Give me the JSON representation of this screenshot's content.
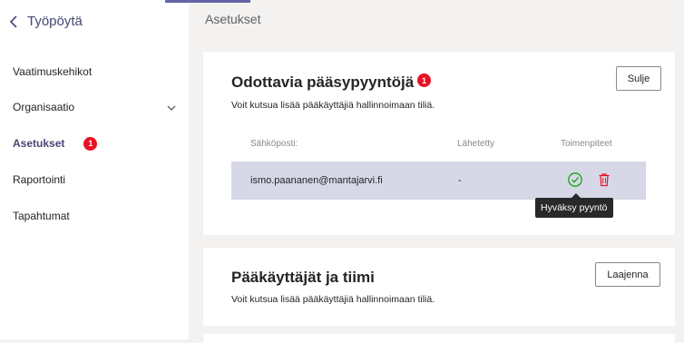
{
  "sidebar": {
    "back_label": "Työpöytä",
    "items": [
      {
        "label": "Vaatimuskehikot"
      },
      {
        "label": "Organisaatio"
      },
      {
        "label": "Asetukset",
        "badge": "1"
      },
      {
        "label": "Raportointi"
      },
      {
        "label": "Tapahtumat"
      }
    ]
  },
  "header": {
    "title": "Asetukset"
  },
  "pending": {
    "title": "Odottavia pääsypyyntöjä",
    "badge": "1",
    "subtitle": "Voit kutsua lisää pääkäyttäjiä hallinnoimaan tiliä.",
    "close_label": "Sulje",
    "columns": [
      "Sähköposti:",
      "Lähetetty",
      "Toimenpiteet"
    ],
    "rows": [
      {
        "email": "ismo.paananen@mantajarvi.fi",
        "sent": "-"
      }
    ],
    "tooltip": "Hyväksy pyyntö"
  },
  "admins": {
    "title": "Pääkäyttäjät ja tiimi",
    "subtitle": "Voit kutsua lisää pääkäyttäjiä hallinnoimaan tiliä.",
    "expand_label": "Laajenna"
  },
  "colors": {
    "accent": "#6264a7",
    "badge": "#e81123",
    "approve": "#13a10e",
    "delete": "#e81123",
    "row_highlight": "#d6d8e7"
  }
}
